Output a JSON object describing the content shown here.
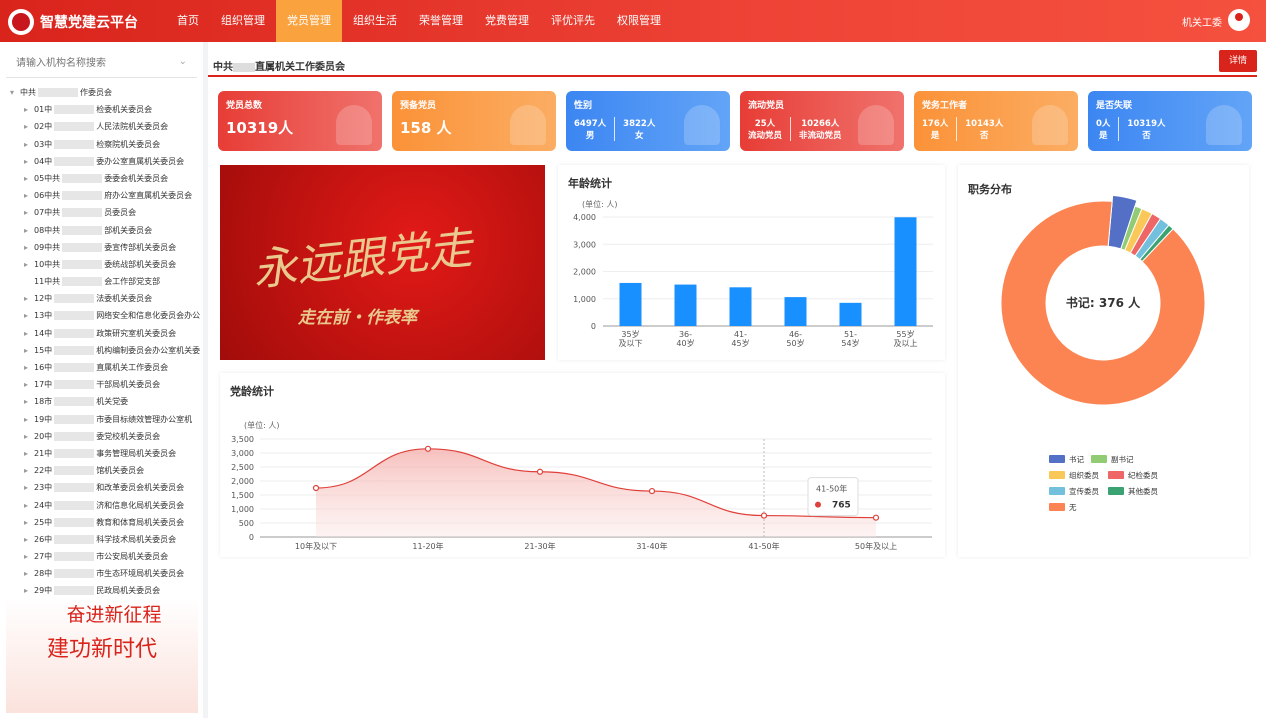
{
  "app": {
    "title": "智慧党建云平台",
    "user": "机关工委"
  },
  "nav": [
    "首页",
    "组织管理",
    "党员管理",
    "组织生活",
    "荣誉管理",
    "党费管理",
    "评优评先",
    "权限管理"
  ],
  "sidebar": {
    "search_placeholder": "请输入机构名称搜索",
    "root": "中共",
    "root_suffix": "作委员会",
    "items": [
      {
        "label": "01中",
        "suffix": "检委机关委员会"
      },
      {
        "label": "02中",
        "suffix": "人民法院机关委员会"
      },
      {
        "label": "03中",
        "suffix": "检察院机关委员会"
      },
      {
        "label": "04中",
        "suffix": "委办公室直属机关委员会"
      },
      {
        "label": "05中共",
        "suffix": "委委会机关委员会"
      },
      {
        "label": "06中共",
        "suffix": "府办公室直属机关委员会"
      },
      {
        "label": "07中共",
        "suffix": "员委员会"
      },
      {
        "label": "08中共",
        "suffix": "部机关委员会"
      },
      {
        "label": "09中共",
        "suffix": "委宣传部机关委员会"
      },
      {
        "label": "10中共",
        "suffix": "委统战部机关委员会"
      },
      {
        "label": "11中共",
        "suffix": "会工作部党支部"
      },
      {
        "label": "12中",
        "suffix": "法委机关委员会"
      },
      {
        "label": "13中",
        "suffix": "网络安全和信息化委员会办公"
      },
      {
        "label": "14中",
        "suffix": "政策研究室机关委员会"
      },
      {
        "label": "15中",
        "suffix": "机构编制委员会办公室机关委"
      },
      {
        "label": "16中",
        "suffix": "直属机关工作委员会"
      },
      {
        "label": "17中",
        "suffix": "干部局机关委员会"
      },
      {
        "label": "18市",
        "suffix": "机关党委"
      },
      {
        "label": "19中",
        "suffix": "市委目标绩效管理办公室机"
      },
      {
        "label": "20中",
        "suffix": "委党校机关委员会"
      },
      {
        "label": "21中",
        "suffix": "事务管理局机关委员会"
      },
      {
        "label": "22中",
        "suffix": "馆机关委员会"
      },
      {
        "label": "23中",
        "suffix": "和改革委员会机关委员会"
      },
      {
        "label": "24中",
        "suffix": "济和信息化局机关委员会"
      },
      {
        "label": "25中",
        "suffix": "教育和体育局机关委员会"
      },
      {
        "label": "26中",
        "suffix": "科学技术局机关委员会"
      },
      {
        "label": "27中",
        "suffix": "市公安局机关委员会"
      },
      {
        "label": "28中",
        "suffix": "市生态环境局机关委员会"
      },
      {
        "label": "29中",
        "suffix": "民政局机关委员会"
      }
    ],
    "promo_line1": "奋进新征程",
    "promo_line2": "建功新时代"
  },
  "header": {
    "org_prefix": "中共",
    "org_suffix": "直属机关工作委员会",
    "detail_button": "详情"
  },
  "stats": [
    {
      "title": "党员总数",
      "value": "10319人",
      "color": "red"
    },
    {
      "title": "预备党员",
      "value": "158 人",
      "color": "orange"
    },
    {
      "title": "性别",
      "left_value": "6497人",
      "left_label": "男",
      "right_value": "3822人",
      "right_label": "女",
      "color": "blue"
    },
    {
      "title": "流动党员",
      "left_value": "25人",
      "left_label": "流动党员",
      "right_value": "10266人",
      "right_label": "非流动党员",
      "color": "red"
    },
    {
      "title": "党务工作者",
      "left_value": "176人",
      "left_label": "是",
      "right_value": "10143人",
      "right_label": "否",
      "color": "orange"
    },
    {
      "title": "是否失联",
      "left_value": "0人",
      "left_label": "是",
      "right_value": "10319人",
      "right_label": "否",
      "color": "blue"
    }
  ],
  "banner": {
    "slogan": "永远跟党走",
    "sub": "走在前・作表率"
  },
  "colors": {
    "primary": "#d9241c",
    "bar": "#1890ff",
    "line": "#e0403a",
    "donut_main": "#f98b52"
  },
  "chart_data": [
    {
      "type": "bar",
      "title": "年龄统计",
      "unit_label": "(单位: 人)",
      "categories": [
        "35岁及以下",
        "36-40岁",
        "41-45岁",
        "46-50岁",
        "51-54岁",
        "55岁及以上"
      ],
      "category_lines": [
        [
          "35岁",
          "及以下"
        ],
        [
          "36-",
          "40岁"
        ],
        [
          "41-",
          "45岁"
        ],
        [
          "46-",
          "50岁"
        ],
        [
          "51-",
          "54岁"
        ],
        [
          "55岁",
          "及以上"
        ]
      ],
      "values": [
        1580,
        1520,
        1420,
        1060,
        850,
        3990
      ],
      "ylim": [
        0,
        4000
      ],
      "yticks": [
        "0",
        "1,000",
        "2,000",
        "3,000",
        "4,000"
      ],
      "grid": true
    },
    {
      "type": "area",
      "title": "党龄统计",
      "unit_label": "(单位: 人)",
      "categories": [
        "10年及以下",
        "11-20年",
        "21-30年",
        "31-40年",
        "41-50年",
        "50年及以上"
      ],
      "values": [
        1750,
        3150,
        2330,
        1640,
        765,
        690
      ],
      "ylim": [
        0,
        3500
      ],
      "yticks": [
        "0",
        "500",
        "1,000",
        "1,500",
        "2,000",
        "2,500",
        "3,000",
        "3,500"
      ],
      "tooltip": {
        "category": "41-50年",
        "value": "765"
      },
      "grid": true
    },
    {
      "type": "pie",
      "title": "职务分布",
      "center_label": "书记: 376 人",
      "slices": [
        {
          "name": "书记",
          "value": 376,
          "color": "#5470c6"
        },
        {
          "name": "副书记",
          "value": 120,
          "color": "#91cc75"
        },
        {
          "name": "组织委员",
          "value": 180,
          "color": "#fac858"
        },
        {
          "name": "纪检委员",
          "value": 160,
          "color": "#ee6666"
        },
        {
          "name": "宣传委员",
          "value": 170,
          "color": "#73c0de"
        },
        {
          "name": "其他委员",
          "value": 90,
          "color": "#3ba272"
        },
        {
          "name": "无",
          "value": 9223,
          "color": "#fc8452"
        }
      ],
      "legend_position": "bottom"
    }
  ]
}
